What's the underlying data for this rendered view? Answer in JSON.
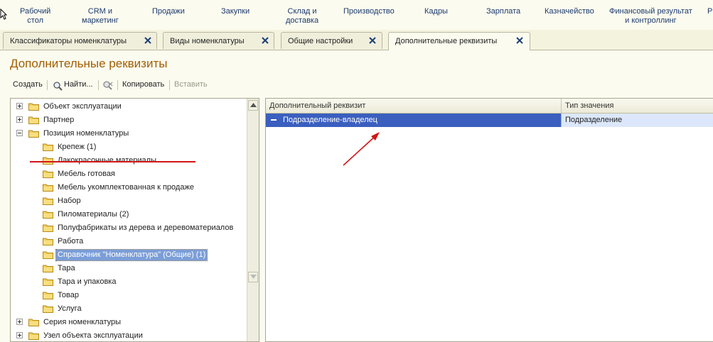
{
  "sections": [
    {
      "label_line1": "Рабочий",
      "label_line2": "стол"
    },
    {
      "label_line1": "CRM и",
      "label_line2": "маркетинг"
    },
    {
      "label_line1": "Продажи",
      "label_line2": ""
    },
    {
      "label_line1": "Закупки",
      "label_line2": ""
    },
    {
      "label_line1": "Склад и",
      "label_line2": "доставка"
    },
    {
      "label_line1": "Производство",
      "label_line2": ""
    },
    {
      "label_line1": "Кадры",
      "label_line2": ""
    },
    {
      "label_line1": "Зарплата",
      "label_line2": ""
    },
    {
      "label_line1": "Казначейство",
      "label_line2": ""
    },
    {
      "label_line1": "Финансовый результат",
      "label_line2": "и контроллинг"
    },
    {
      "label_line1": "Р",
      "label_line2": ""
    }
  ],
  "tabs": [
    {
      "label": "Классификаторы номенклатуры",
      "active": false
    },
    {
      "label": "Виды номенклатуры",
      "active": false
    },
    {
      "label": "Общие настройки",
      "active": false
    },
    {
      "label": "Дополнительные реквизиты",
      "active": true
    }
  ],
  "page": {
    "title": "Дополнительные реквизиты"
  },
  "toolbar": {
    "create": "Создать",
    "find": "Найти...",
    "copy": "Копировать",
    "paste": "Вставить"
  },
  "tree": [
    {
      "label": "Объект эксплуатации",
      "level": 0,
      "expander": "plus"
    },
    {
      "label": "Партнер",
      "level": 0,
      "expander": "plus"
    },
    {
      "label": "Позиция номенклатуры",
      "level": 0,
      "expander": "minus"
    },
    {
      "label": "Крепеж (1)",
      "level": 1
    },
    {
      "label": "Лакокрасочные материалы",
      "level": 1
    },
    {
      "label": "Мебель готовая",
      "level": 1
    },
    {
      "label": "Мебель укомплектованная к продаже",
      "level": 1
    },
    {
      "label": "Набор",
      "level": 1
    },
    {
      "label": "Пиломатериалы (2)",
      "level": 1
    },
    {
      "label": "Полуфабрикаты из дерева и деревоматериалов",
      "level": 1
    },
    {
      "label": "Работа",
      "level": 1
    },
    {
      "label": "Справочник \"Номенклатура\" (Общие) (1)",
      "level": 1,
      "selected": true
    },
    {
      "label": "Тара",
      "level": 1
    },
    {
      "label": "Тара и упаковка",
      "level": 1
    },
    {
      "label": "Товар",
      "level": 1
    },
    {
      "label": "Услуга",
      "level": 1
    },
    {
      "label": "Серия номенклатуры",
      "level": 0,
      "expander": "plus"
    },
    {
      "label": "Узел объекта эксплуатации",
      "level": 0,
      "expander": "plus"
    }
  ],
  "grid": {
    "columns": [
      "Дополнительный реквизит",
      "Тип значения"
    ],
    "rows": [
      {
        "attribute": "Подразделение-владелец",
        "type": "Подразделение"
      }
    ]
  },
  "colors": {
    "title": "#a35d00",
    "section_text": "#1c3a6e",
    "selection": "#3b5fbf",
    "annotation": "#d21616"
  }
}
